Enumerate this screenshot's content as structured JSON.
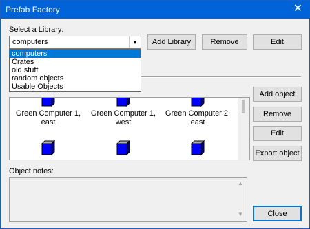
{
  "window": {
    "title": "Prefab Factory"
  },
  "library": {
    "label": "Select a Library:",
    "selected": "computers",
    "options": [
      "computers",
      "Crates",
      "old stuff",
      "random objects",
      "Usable Objects"
    ]
  },
  "buttons": {
    "add_library": "Add Library",
    "remove_library": "Remove",
    "edit_library": "Edit",
    "add_object": "Add object",
    "remove_object": "Remove",
    "edit_object": "Edit",
    "export_object": "Export object",
    "close": "Close"
  },
  "objects": [
    {
      "line1": "Green Computer 1,",
      "line2": "east"
    },
    {
      "line1": "Green Computer 1,",
      "line2": "west"
    },
    {
      "line1": "Green Computer 2,",
      "line2": "east"
    }
  ],
  "notes": {
    "label": "Object notes:"
  },
  "colors": {
    "cube_front": "#0000ff",
    "cube_top": "#b0b0b0",
    "cube_side": "#00008b",
    "accent": "#0078d7"
  }
}
